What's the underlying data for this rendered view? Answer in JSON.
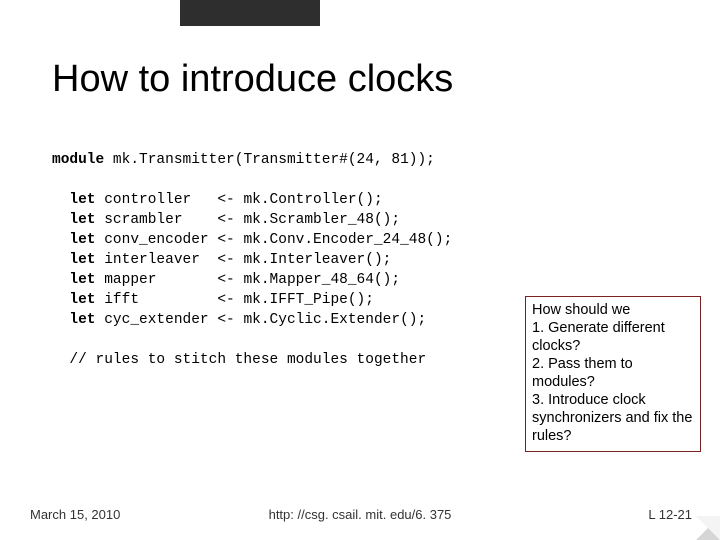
{
  "title": "How to introduce clocks",
  "code": {
    "module_kw": "module",
    "module_decl": " mk.Transmitter(Transmitter#(24, 81));",
    "let": "let",
    "lines": [
      {
        "body": " controller   <- mk.Controller();"
      },
      {
        "body": " scrambler    <- mk.Scrambler_48();"
      },
      {
        "body": " conv_encoder <- mk.Conv.Encoder_24_48();"
      },
      {
        "body": " interleaver  <- mk.Interleaver();"
      },
      {
        "body": " mapper       <- mk.Mapper_48_64();"
      },
      {
        "body": " ifft         <- mk.IFFT_Pipe();"
      },
      {
        "body": " cyc_extender <- mk.Cyclic.Extender();"
      }
    ],
    "comment": "// rules to stitch these modules together"
  },
  "side": {
    "q": "How should we",
    "p1": "1. Generate different clocks?",
    "p2": "2. Pass them to modules?",
    "p3": "3. Introduce clock synchronizers and fix the rules?"
  },
  "footer": {
    "date": "March 15, 2010",
    "url": "http: //csg. csail. mit. edu/6. 375",
    "page": "L 12-21"
  }
}
